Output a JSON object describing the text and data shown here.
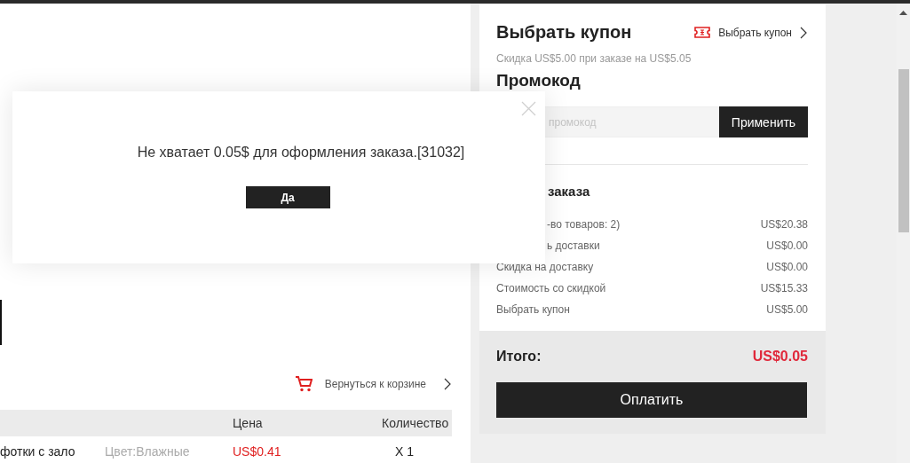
{
  "cart_link": {
    "label": "Вернуться к корзине"
  },
  "table": {
    "columns": [
      {
        "label": "Цена"
      },
      {
        "label": "Количество"
      }
    ],
    "rows": [
      {
        "product": "фотки с зало",
        "variant": "Цвет:Влажные",
        "price": "US$0.41",
        "quantity": "X 1"
      }
    ]
  },
  "coupon": {
    "title": "Выбрать купон",
    "link": "Выбрать купон",
    "subtitle": "Скидка US$5.00 при заказе на US$5.05"
  },
  "promo": {
    "title": "Промокод",
    "placeholder": "промокод",
    "button": "Применить"
  },
  "summary": {
    "title": "заказа",
    "rows": [
      {
        "label": "-во товаров: 2)",
        "value": "US$20.38",
        "covered": true
      },
      {
        "label": "ь доставки",
        "value": "US$0.00",
        "covered": true
      },
      {
        "label": "Скидка на доставку",
        "value": "US$0.00",
        "covered": false
      },
      {
        "label": "Стоимость со скидкой",
        "value": "US$15.33",
        "covered": false
      },
      {
        "label": "Выбрать купон",
        "value": "US$5.00",
        "covered": false
      }
    ],
    "total_label": "Итого:",
    "total_value": "US$0.05",
    "pay_button": "Оплатить"
  },
  "dialog": {
    "message": "Не хватает 0.05$ для оформления заказа.[31032]",
    "button": "Да"
  }
}
